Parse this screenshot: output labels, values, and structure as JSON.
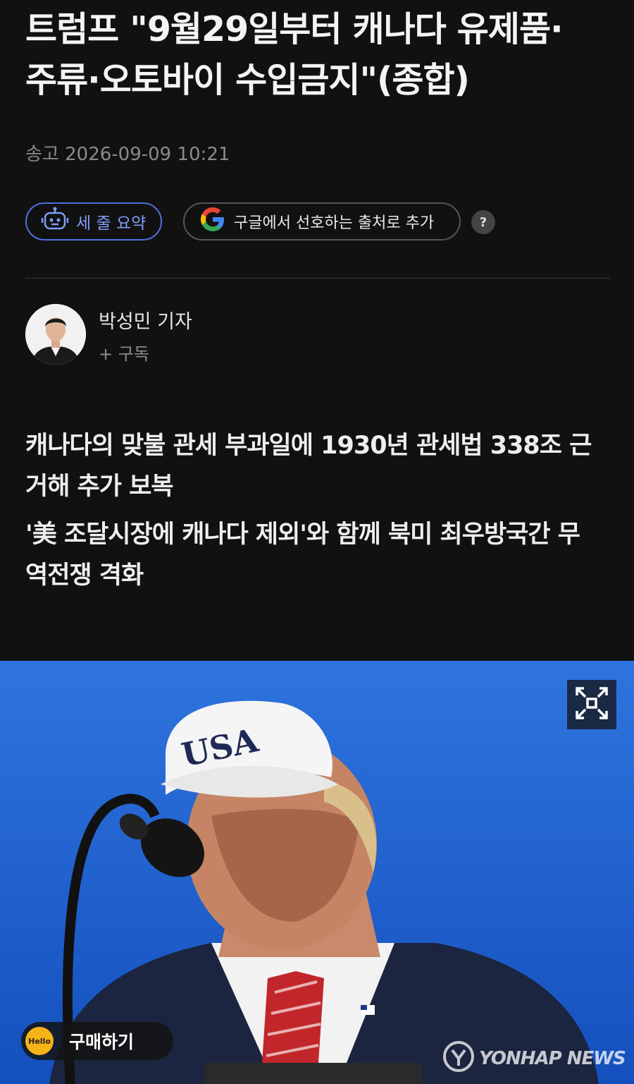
{
  "article": {
    "title_line1": "트럼프 \"9월29일부터 캐나다 유제품·",
    "title_line2": "주류·오토바이 수입금지\"(종합)",
    "date": "송고 2026-09-09 10:21"
  },
  "actions": {
    "summary_label": "세 줄 요약",
    "google_label": "구글에서 선호하는 출처로 추가",
    "help_label": "?"
  },
  "reporter": {
    "name": "박성민 기자",
    "subscribe_label": "+ 구독"
  },
  "summary": {
    "line1a": "캐나다의 맞불 관세 부과일에 1930년 관세법 338조 근",
    "line1b": "거해 추가 보복",
    "line2a": "'美 조달시장에 캐나다 제외'와 함께 북미 최우방국간 무",
    "line2b": "역전쟁 격화"
  },
  "photo": {
    "cap_text": "USA",
    "buy_logo": "Hello",
    "buy_label": "구매하기",
    "watermark": "YONHAP NEWS"
  },
  "colors": {
    "background": "#111111",
    "accent_blue": "#4f6fe0",
    "sky": "#1d5dcf"
  }
}
